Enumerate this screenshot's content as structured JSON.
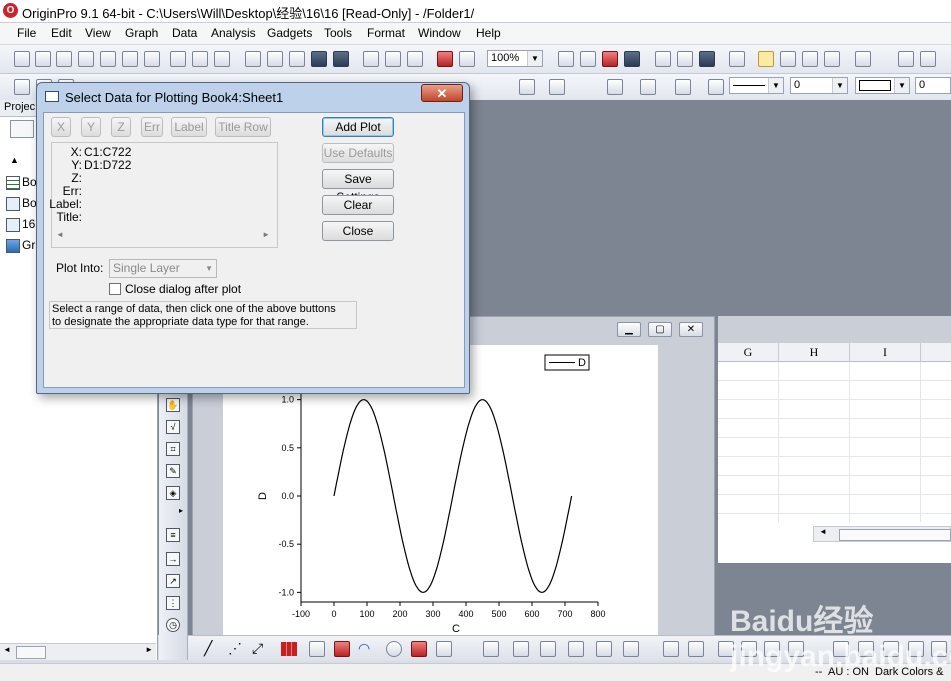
{
  "window": {
    "title": "OriginPro 9.1 64-bit - C:\\Users\\Will\\Desktop\\经验\\16\\16 [Read-Only] - /Folder1/"
  },
  "menu": [
    "File",
    "Edit",
    "View",
    "Graph",
    "Data",
    "Analysis",
    "Gadgets",
    "Tools",
    "Format",
    "Window",
    "Help"
  ],
  "toolbar": {
    "zoom_value": "100%",
    "line_style_value": "",
    "line_width_value": "0",
    "fill_value": "0"
  },
  "project": {
    "header": "Projec",
    "items": [
      "Bo",
      "Bo",
      "16",
      "Gr"
    ]
  },
  "dialog": {
    "title": "Select Data for Plotting  Book4:Sheet1",
    "close_glyph": "✕",
    "type_buttons": [
      "X",
      "Y",
      "Z",
      "Err",
      "Label",
      "Title Row"
    ],
    "assign_labels": [
      "X:",
      "Y:",
      "Z:",
      "Err:",
      "Label:",
      "Title:"
    ],
    "assign_values": [
      "C1:C722",
      "D1:D722",
      "",
      "",
      "",
      ""
    ],
    "buttons": {
      "add_plot": "Add Plot",
      "use_defaults": "Use Defaults",
      "save_settings": "Save Settings",
      "clear": "Clear",
      "close": "Close"
    },
    "plot_into_label": "Plot Into:",
    "plot_into_value": "Single Layer",
    "close_after_label": "Close dialog after plot",
    "close_after_checked": false,
    "hint_line1": "Select a range of data, then click one of the above buttons",
    "hint_line2": "to designate the appropriate data type for that range."
  },
  "graph": {
    "legend": "D",
    "xlabel": "C",
    "ylabel": "D",
    "x_ticks": [
      "-100",
      "0",
      "100",
      "200",
      "300",
      "400",
      "500",
      "600",
      "700",
      "800"
    ],
    "y_ticks": [
      "1.0",
      "0.5",
      "0.0",
      "-0.5",
      "-1.0"
    ]
  },
  "chart_data": {
    "type": "line",
    "xlabel": "C",
    "ylabel": "D",
    "xlim": [
      -100,
      800
    ],
    "ylim": [
      -1.1,
      1.1
    ],
    "series": [
      {
        "name": "D",
        "x": [
          0,
          45,
          90,
          135,
          180,
          225,
          270,
          315,
          360,
          405,
          450,
          495,
          540,
          585,
          630,
          675,
          720
        ],
        "values": [
          0,
          0.71,
          1,
          0.71,
          0,
          -0.71,
          -1,
          -0.71,
          0,
          0.71,
          1,
          0.71,
          0,
          -0.71,
          -1,
          -0.71,
          0
        ]
      }
    ]
  },
  "worksheet": {
    "columns": [
      "G",
      "H",
      "I"
    ]
  },
  "status": {
    "au": "AU : ON",
    "theme": "Dark Colors &",
    "left": "--"
  },
  "watermark": "Baidu经验 jingyan.baidu.com"
}
